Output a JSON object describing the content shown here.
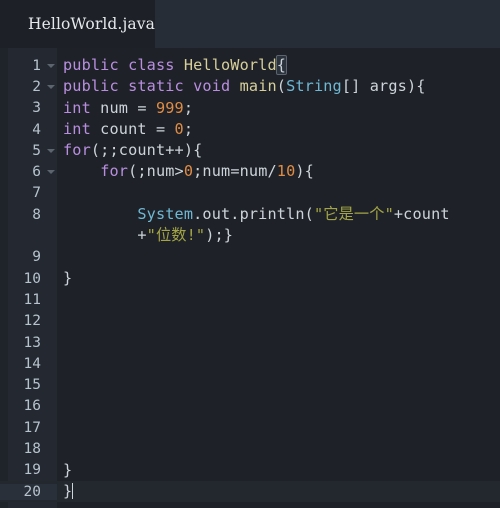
{
  "window": {
    "bg": "#1e2228",
    "tabbar_bg": "#262d36",
    "gutter_bg": "#232831",
    "current_line_bg": "#23272e"
  },
  "tabbar": {
    "active_tab": {
      "label": "HelloWorld.java",
      "filetype": "java"
    }
  },
  "theme": {
    "keyword": "#b98ee0",
    "type_name": "#d6cf9a",
    "class_ref": "#6fb8d4",
    "number": "#e08c45",
    "string": "#a3a545",
    "plain": "#cdd3da",
    "line_number": "#b6c2cc",
    "fold_arrow": "#5d646e"
  },
  "editor": {
    "cursor_line": 20,
    "total_lines": 20,
    "lines": [
      {
        "n": "1",
        "fold": true,
        "tokens": [
          {
            "t": "public",
            "c": "kw"
          },
          {
            "t": " ",
            "c": "pln"
          },
          {
            "t": "class",
            "c": "kw"
          },
          {
            "t": " ",
            "c": "pln"
          },
          {
            "t": "HelloWorld",
            "c": "typ"
          },
          {
            "t": "{",
            "c": "pun",
            "hl": true
          }
        ]
      },
      {
        "n": "2",
        "fold": true,
        "tokens": [
          {
            "t": "public",
            "c": "kw"
          },
          {
            "t": " ",
            "c": "pln"
          },
          {
            "t": "static",
            "c": "kw"
          },
          {
            "t": " ",
            "c": "pln"
          },
          {
            "t": "void",
            "c": "kw"
          },
          {
            "t": " ",
            "c": "pln"
          },
          {
            "t": "main",
            "c": "fn"
          },
          {
            "t": "(",
            "c": "pun"
          },
          {
            "t": "String",
            "c": "cls"
          },
          {
            "t": "[] ",
            "c": "pun"
          },
          {
            "t": "args",
            "c": "pln"
          },
          {
            "t": "){",
            "c": "pun"
          }
        ]
      },
      {
        "n": "3",
        "fold": false,
        "tokens": [
          {
            "t": "int",
            "c": "kw"
          },
          {
            "t": " num = ",
            "c": "pln"
          },
          {
            "t": "999",
            "c": "num"
          },
          {
            "t": ";",
            "c": "pun"
          }
        ]
      },
      {
        "n": "4",
        "fold": false,
        "tokens": [
          {
            "t": "int",
            "c": "kw"
          },
          {
            "t": " count = ",
            "c": "pln"
          },
          {
            "t": "0",
            "c": "num"
          },
          {
            "t": ";",
            "c": "pun"
          }
        ]
      },
      {
        "n": "5",
        "fold": true,
        "tokens": [
          {
            "t": "for",
            "c": "kw"
          },
          {
            "t": "(;;count++){",
            "c": "pun"
          }
        ]
      },
      {
        "n": "6",
        "fold": true,
        "tokens": [
          {
            "t": "    ",
            "c": "pln"
          },
          {
            "t": "for",
            "c": "kw"
          },
          {
            "t": "(;num>",
            "c": "pun"
          },
          {
            "t": "0",
            "c": "num"
          },
          {
            "t": ";num=num/",
            "c": "pun"
          },
          {
            "t": "10",
            "c": "num"
          },
          {
            "t": "){",
            "c": "pun"
          }
        ]
      },
      {
        "n": "7",
        "fold": false,
        "tokens": []
      },
      {
        "n": "8",
        "fold": false,
        "tokens": [
          {
            "t": "        ",
            "c": "pln"
          },
          {
            "t": "System",
            "c": "cls"
          },
          {
            "t": ".out.println(",
            "c": "pun"
          },
          {
            "t": "\"它是一个\"",
            "c": "str"
          },
          {
            "t": "+count",
            "c": "pln"
          }
        ]
      },
      {
        "n": "",
        "fold": false,
        "cont": true,
        "tokens": [
          {
            "t": "        ",
            "c": "pln"
          },
          {
            "t": "+",
            "c": "pun"
          },
          {
            "t": "\"位数!\"",
            "c": "str"
          },
          {
            "t": ");}",
            "c": "pun"
          }
        ]
      },
      {
        "n": "9",
        "fold": false,
        "tokens": []
      },
      {
        "n": "10",
        "fold": false,
        "tokens": [
          {
            "t": "}",
            "c": "pun"
          }
        ]
      },
      {
        "n": "11",
        "fold": false,
        "tokens": []
      },
      {
        "n": "12",
        "fold": false,
        "tokens": []
      },
      {
        "n": "13",
        "fold": false,
        "tokens": []
      },
      {
        "n": "14",
        "fold": false,
        "tokens": []
      },
      {
        "n": "15",
        "fold": false,
        "tokens": []
      },
      {
        "n": "16",
        "fold": false,
        "tokens": []
      },
      {
        "n": "17",
        "fold": false,
        "tokens": []
      },
      {
        "n": "18",
        "fold": false,
        "tokens": []
      },
      {
        "n": "19",
        "fold": false,
        "tokens": [
          {
            "t": "}",
            "c": "pun"
          }
        ]
      },
      {
        "n": "20",
        "fold": false,
        "current": true,
        "caret": true,
        "tokens": [
          {
            "t": "}",
            "c": "pun"
          }
        ]
      }
    ]
  }
}
